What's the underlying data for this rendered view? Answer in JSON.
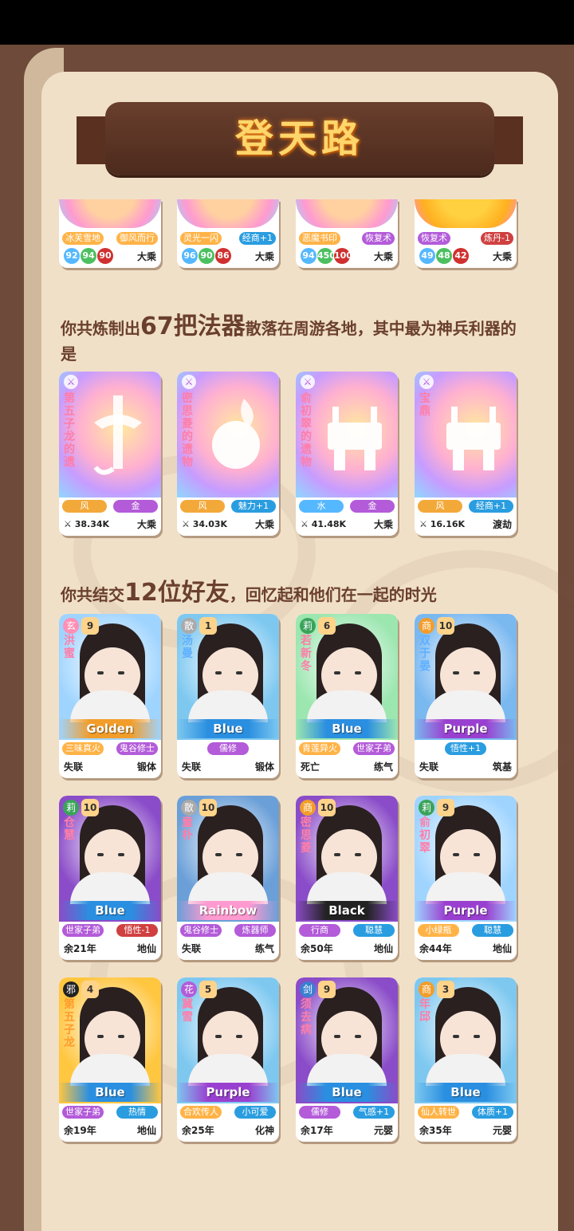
{
  "title": "登天路",
  "top_cards": [
    {
      "tags": [
        "冰芙雪地",
        "御风而行"
      ],
      "stats": [
        "92",
        "94",
        "90"
      ],
      "realm": "大乘",
      "tag_colors": [
        "#ffb347",
        "#ffb347"
      ]
    },
    {
      "tags": [
        "灵光一闪",
        "经商+1"
      ],
      "stats": [
        "96",
        "90",
        "86"
      ],
      "realm": "大乘",
      "tag_colors": [
        "#ffb347",
        "#2a9de0"
      ]
    },
    {
      "tags": [
        "恶魔书印",
        "恢复术"
      ],
      "stats": [
        "94",
        "450",
        "100"
      ],
      "realm": "大乘",
      "tag_colors": [
        "#ffb347",
        "#b35bd9"
      ]
    },
    {
      "tags": [
        "恢复术",
        "炼丹-1"
      ],
      "stats": [
        "49",
        "48",
        "42"
      ],
      "realm": "大乘",
      "tag_colors": [
        "#b35bd9",
        "#d04040"
      ]
    }
  ],
  "section_weapons": {
    "pre": "你共炼制出",
    "big": "67把法器",
    "post": "散落在周游各地，其中最为神兵利器的是"
  },
  "weapons": [
    {
      "name": "第五子龙的遗",
      "tags": [
        "风",
        "金"
      ],
      "power": "38.34K",
      "realm": "大乘",
      "tag2_color": "#b35bd9",
      "tag1_color": "#f3a93a"
    },
    {
      "name": "密思菱的遗物",
      "tags": [
        "风",
        "魅力+1"
      ],
      "power": "34.03K",
      "realm": "大乘",
      "tag2_color": "#2a9de0",
      "tag1_color": "#f3a93a"
    },
    {
      "name": "俞初翠的遗物",
      "tags": [
        "水",
        "金"
      ],
      "power": "41.48K",
      "realm": "大乘",
      "tag2_color": "#b35bd9",
      "tag1_color": "#55b8ff"
    },
    {
      "name": "宝鼎",
      "tags": [
        "风",
        "经商+1"
      ],
      "power": "16.16K",
      "realm": "渡劫",
      "tag2_color": "#2a9de0",
      "tag1_color": "#f3a93a"
    }
  ],
  "section_friends": {
    "pre": "你共结交",
    "big": "12位好友",
    "post": "，回忆起和他们在一起的时光"
  },
  "friends": [
    {
      "sect": "玄",
      "level": "9",
      "name": "洪蜜",
      "rank": "Golden",
      "tags": [
        "三味真火",
        "鬼谷修士"
      ],
      "status": "失联",
      "realm": "锻体",
      "bg": "#9fd4ff",
      "sect_color": "#ff8fb5",
      "rank_color": "#f29d2a",
      "tag_colors": [
        "#ffb347",
        "#b35bd9"
      ],
      "name_color": "p"
    },
    {
      "sect": "散",
      "level": "1",
      "name": "汤曼",
      "rank": "Blue",
      "tags": [
        "儒修"
      ],
      "status": "失联",
      "realm": "锻体",
      "bg": "#7ec8f0",
      "sect_color": "#aaaaaa",
      "rank_color": "#2a8fe0",
      "tag_colors": [
        "#b35bd9"
      ],
      "name_color": "b"
    },
    {
      "sect": "莉",
      "level": "6",
      "name": "若新冬",
      "rank": "Blue",
      "tags": [
        "青莲异火",
        "世家子弟"
      ],
      "status": "死亡",
      "realm": "练气",
      "bg": "#9ce6b0",
      "sect_color": "#3aa35a",
      "rank_color": "#2a8fe0",
      "tag_colors": [
        "#ffb347",
        "#b35bd9"
      ],
      "name_color": "p"
    },
    {
      "sect": "商",
      "level": "10",
      "name": "双于晏",
      "rank": "Purple",
      "tags": [
        "悟性+1"
      ],
      "status": "失联",
      "realm": "筑基",
      "bg": "#7ab8f0",
      "sect_color": "#f29d2a",
      "rank_color": "#9a40d0",
      "tag_colors": [
        "#2a9de0"
      ],
      "name_color": "b"
    },
    {
      "sect": "莉",
      "level": "10",
      "name": "仓慧",
      "rank": "Blue",
      "tags": [
        "世家子弟",
        "悟性-1"
      ],
      "status": "余21年",
      "realm": "地仙",
      "bg": "#8a4cc8",
      "sect_color": "#3aa35a",
      "rank_color": "#2a8fe0",
      "tag_colors": [
        "#b35bd9",
        "#d04040"
      ],
      "name_color": "p"
    },
    {
      "sect": "散",
      "level": "10",
      "name": "童朴",
      "rank": "Rainbow",
      "tags": [
        "鬼谷修士",
        "炼器师"
      ],
      "status": "失联",
      "realm": "练气",
      "bg": "#6a9fd8",
      "sect_color": "#aaaaaa",
      "rank_color": "#ff9ad0",
      "tag_colors": [
        "#b35bd9",
        "#b35bd9"
      ],
      "name_color": "p"
    },
    {
      "sect": "商",
      "level": "10",
      "name": "密思菱",
      "rank": "Black",
      "tags": [
        "行商",
        "聪慧"
      ],
      "status": "余50年",
      "realm": "地仙",
      "bg": "#8a4cc8",
      "sect_color": "#f29d2a",
      "rank_color": "#222222",
      "tag_colors": [
        "#b35bd9",
        "#2a9de0"
      ],
      "name_color": "p"
    },
    {
      "sect": "莉",
      "level": "9",
      "name": "俞初翠",
      "rank": "Purple",
      "tags": [
        "小绿瓶",
        "聪慧"
      ],
      "status": "余44年",
      "realm": "地仙",
      "bg": "#9fd4ff",
      "sect_color": "#3aa35a",
      "rank_color": "#9a40d0",
      "tag_colors": [
        "#ffb347",
        "#2a9de0"
      ],
      "name_color": "p"
    },
    {
      "sect": "邪",
      "level": "4",
      "name": "第五子龙",
      "rank": "Blue",
      "tags": [
        "世家子弟",
        "热情"
      ],
      "status": "余19年",
      "realm": "地仙",
      "bg": "#ffc640",
      "sect_color": "#222222",
      "rank_color": "#2a8fe0",
      "tag_colors": [
        "#b35bd9",
        "#2a9de0"
      ],
      "name_color": "o"
    },
    {
      "sect": "花",
      "level": "5",
      "name": "冀雪",
      "rank": "Purple",
      "tags": [
        "合欢传人",
        "小可爱"
      ],
      "status": "余25年",
      "realm": "化神",
      "bg": "#7ec8f0",
      "sect_color": "#b35bd9",
      "rank_color": "#9a40d0",
      "tag_colors": [
        "#ffb347",
        "#2a9de0"
      ],
      "name_color": "p"
    },
    {
      "sect": "剑",
      "level": "9",
      "name": "须去病",
      "rank": "Blue",
      "tags": [
        "儒修",
        "气感+1"
      ],
      "status": "余17年",
      "realm": "元婴",
      "bg": "#8a4cc8",
      "sect_color": "#3a7fd0",
      "rank_color": "#2a8fe0",
      "tag_colors": [
        "#b35bd9",
        "#2a9de0"
      ],
      "name_color": "p"
    },
    {
      "sect": "商",
      "level": "3",
      "name": "年邱",
      "rank": "Blue",
      "tags": [
        "仙人转世",
        "体质+1"
      ],
      "status": "余35年",
      "realm": "元婴",
      "bg": "#7ec8f0",
      "sect_color": "#f29d2a",
      "rank_color": "#2a8fe0",
      "tag_colors": [
        "#ffb347",
        "#2a9de0"
      ],
      "name_color": "p"
    }
  ],
  "colors": {
    "brown": "#6a3f2d",
    "stat_blue": "#55b8ff",
    "stat_green": "#4cc060",
    "stat_red": "#d03030"
  }
}
